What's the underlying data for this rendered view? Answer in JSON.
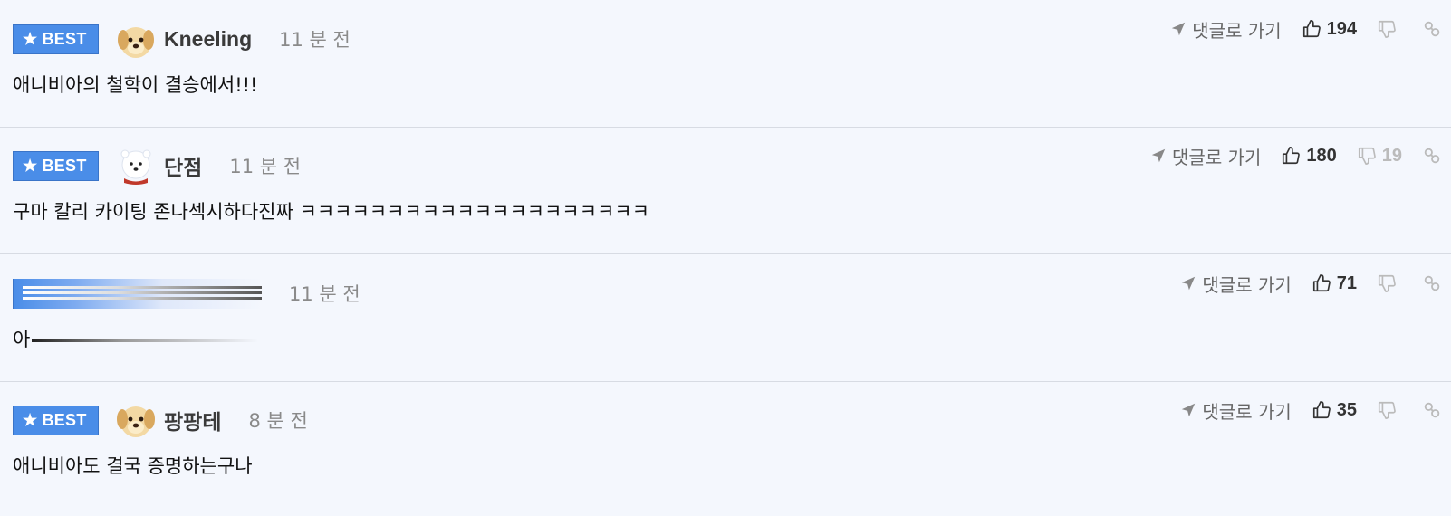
{
  "colors": {
    "background": "#f4f7fd",
    "best_badge": "#4a8de8",
    "divider": "#d7dbe3",
    "muted": "#8a8a8a"
  },
  "labels": {
    "best": "BEST",
    "goto_reply": "댓글로 가기"
  },
  "icons": {
    "star": "star-icon",
    "goto": "navigation-arrow-icon",
    "like": "thumbs-up-icon",
    "dislike": "thumbs-down-icon",
    "link": "link-icon"
  },
  "comments": [
    {
      "best": true,
      "avatar": "puppy-avatar",
      "nickname": "Kneeling",
      "time": "11 분 전",
      "text": "애니비아의 철학이 결승에서!!!",
      "likes": "194",
      "dislikes": ""
    },
    {
      "best": true,
      "avatar": "polar-bear-avatar",
      "nickname": "단점",
      "time": "11 분 전",
      "text": "구마 칼리 카이팅 존나섹시하다진짜 ㅋㅋㅋㅋㅋㅋㅋㅋㅋㅋㅋㅋㅋㅋㅋㅋㅋㅋㅋㅋ",
      "likes": "180",
      "dislikes": "19"
    },
    {
      "best": false,
      "avatar": "",
      "nickname": "",
      "time": "11 분 전",
      "text": "아",
      "likes": "71",
      "dislikes": ""
    },
    {
      "best": true,
      "avatar": "puppy-avatar",
      "nickname": "팡팡테",
      "time": "8 분 전",
      "text": "애니비아도 결국 증명하는구나",
      "likes": "35",
      "dislikes": ""
    }
  ]
}
